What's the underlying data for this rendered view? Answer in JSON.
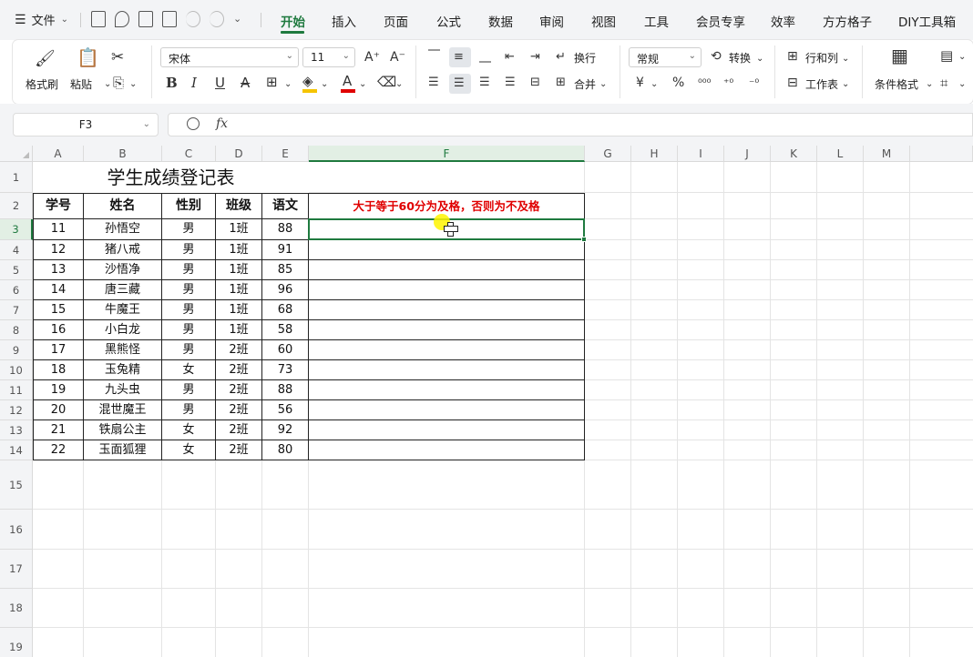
{
  "menubar": {
    "file_label": "文件",
    "tabs": [
      "开始",
      "插入",
      "页面",
      "公式",
      "数据",
      "审阅",
      "视图",
      "工具",
      "会员专享",
      "效率",
      "方方格子",
      "DIY工具箱"
    ],
    "active_tab": "开始"
  },
  "ribbon": {
    "format_painter": "格式刷",
    "paste": "粘贴",
    "font_name": "宋体",
    "font_size": "11",
    "wrap_text": "换行",
    "merge": "合并",
    "number_format": "常规",
    "convert": "转换",
    "rows_cols": "行和列",
    "worksheet": "工作表",
    "conditional_format": "条件格式"
  },
  "formula_bar": {
    "cell_ref": "F3",
    "fx_label": "fx",
    "content": ""
  },
  "grid": {
    "columns": [
      "A",
      "B",
      "C",
      "D",
      "E",
      "F",
      "G",
      "H",
      "I",
      "J",
      "K",
      "L",
      "M"
    ],
    "selected_column": "F",
    "rows": [
      "1",
      "2",
      "3",
      "4",
      "5",
      "6",
      "7",
      "8",
      "9",
      "10",
      "11",
      "12",
      "13",
      "14",
      "15",
      "16",
      "17",
      "18",
      "19"
    ],
    "selected_row": "3"
  },
  "sheet": {
    "title": "学生成绩登记表",
    "headers": [
      "学号",
      "姓名",
      "性别",
      "班级",
      "语文"
    ],
    "note": "大于等于60分为及格，否则为不及格",
    "records": [
      [
        "11",
        "孙悟空",
        "男",
        "1班",
        "88"
      ],
      [
        "12",
        "猪八戒",
        "男",
        "1班",
        "91"
      ],
      [
        "13",
        "沙悟净",
        "男",
        "1班",
        "85"
      ],
      [
        "14",
        "唐三藏",
        "男",
        "1班",
        "96"
      ],
      [
        "15",
        "牛魔王",
        "男",
        "1班",
        "68"
      ],
      [
        "16",
        "小白龙",
        "男",
        "1班",
        "58"
      ],
      [
        "17",
        "黑熊怪",
        "男",
        "2班",
        "60"
      ],
      [
        "18",
        "玉兔精",
        "女",
        "2班",
        "73"
      ],
      [
        "19",
        "九头虫",
        "男",
        "2班",
        "88"
      ],
      [
        "20",
        "混世魔王",
        "男",
        "2班",
        "56"
      ],
      [
        "21",
        "铁扇公主",
        "女",
        "2班",
        "92"
      ],
      [
        "22",
        "玉面狐狸",
        "女",
        "2班",
        "80"
      ]
    ]
  },
  "colors": {
    "accent": "#1f7a3f",
    "note_red": "#e00000"
  }
}
